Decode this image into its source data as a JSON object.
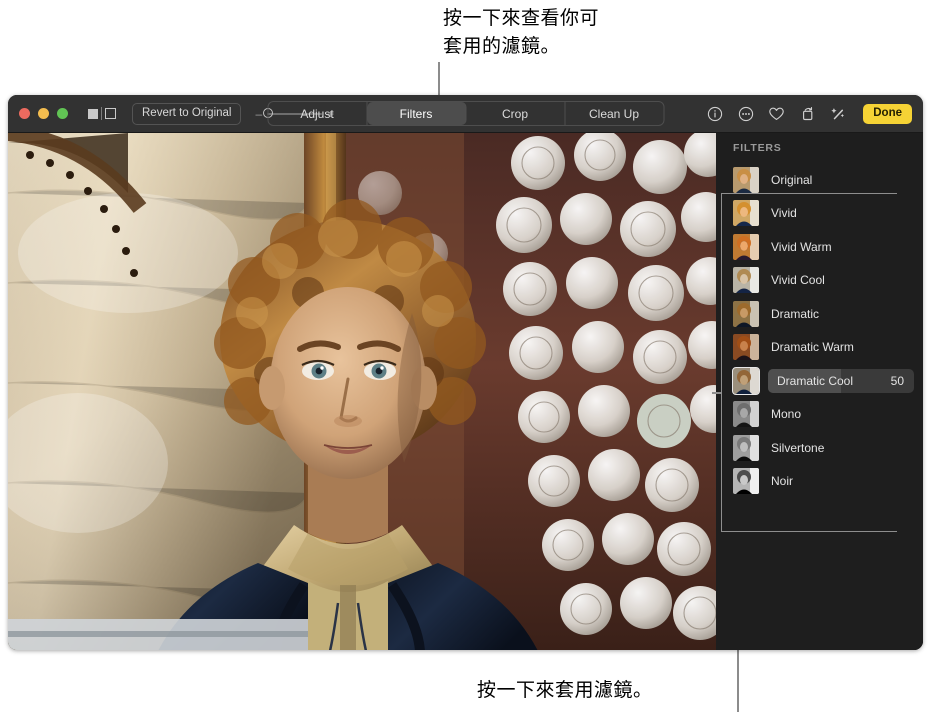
{
  "annotations": {
    "top": "按一下來查看你可\n套用的濾鏡。",
    "bottom": "按一下來套用濾鏡。"
  },
  "window": {
    "toolbar": {
      "traffic_lights": [
        "close",
        "minimize",
        "zoom"
      ],
      "view_toggle": {
        "name": "view-mode-toggle"
      },
      "revert_label": "Revert to Original",
      "zoom_slider": {
        "minus": "–",
        "plus": "+",
        "value": 0
      },
      "tabs": [
        {
          "label": "Adjust",
          "active": false
        },
        {
          "label": "Filters",
          "active": true
        },
        {
          "label": "Crop",
          "active": false
        },
        {
          "label": "Clean Up",
          "active": false
        }
      ],
      "icons": [
        "info-icon",
        "more-options-icon",
        "favorite-heart-icon",
        "rotate-icon",
        "enhance-wand-icon"
      ],
      "done_label": "Done"
    },
    "sidebar": {
      "title": "FILTERS",
      "filters": [
        {
          "label": "Original",
          "value": null,
          "selected": false,
          "tone": "original"
        },
        {
          "label": "Vivid",
          "value": null,
          "selected": false,
          "tone": "vivid"
        },
        {
          "label": "Vivid Warm",
          "value": null,
          "selected": false,
          "tone": "vivid-warm"
        },
        {
          "label": "Vivid Cool",
          "value": null,
          "selected": false,
          "tone": "vivid-cool"
        },
        {
          "label": "Dramatic",
          "value": null,
          "selected": false,
          "tone": "dramatic"
        },
        {
          "label": "Dramatic Warm",
          "value": null,
          "selected": false,
          "tone": "dramatic-warm"
        },
        {
          "label": "Dramatic Cool",
          "value": "50",
          "selected": true,
          "tone": "dramatic-cool"
        },
        {
          "label": "Mono",
          "value": null,
          "selected": false,
          "tone": "mono"
        },
        {
          "label": "Silvertone",
          "value": null,
          "selected": false,
          "tone": "silvertone"
        },
        {
          "label": "Noir",
          "value": null,
          "selected": false,
          "tone": "noir"
        }
      ]
    }
  },
  "colors": {
    "toolbar_bg": "#323232",
    "sidebar_bg": "#1e1e1e",
    "accent_done": "#f6d335",
    "selected_row": "#3a3a3a",
    "leader_line": "#8c8c8c"
  }
}
